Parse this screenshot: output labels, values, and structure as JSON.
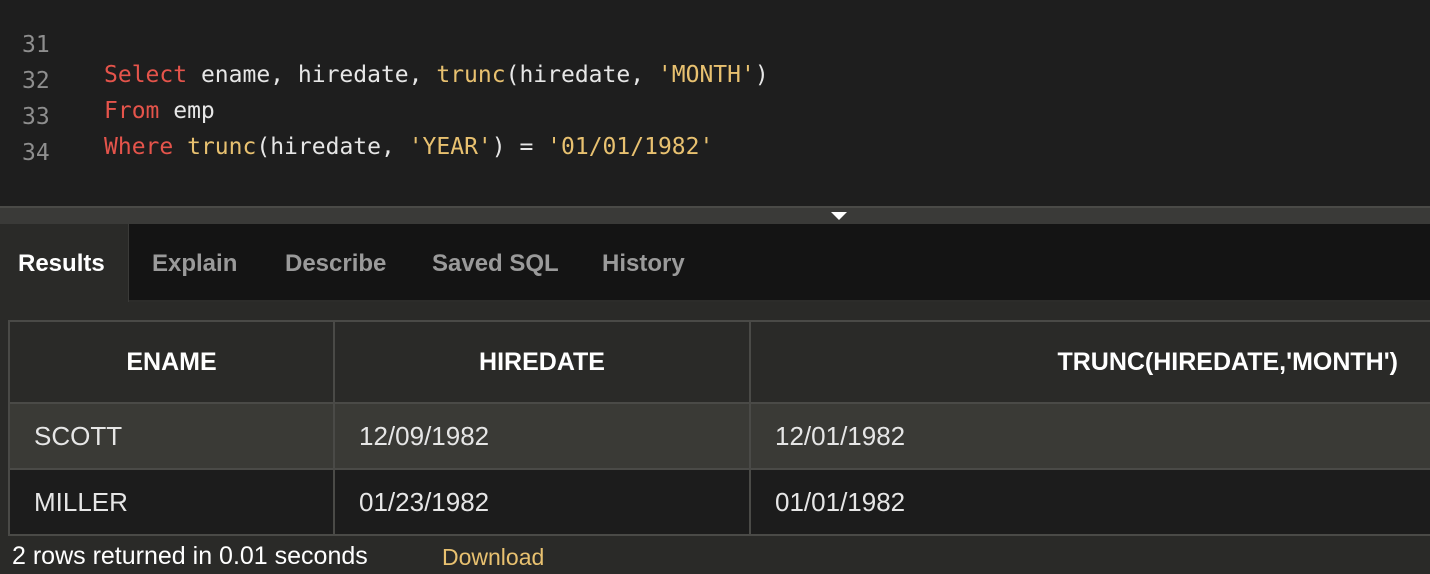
{
  "editor": {
    "lines": [
      {
        "number": "31",
        "t1": "Select",
        "t2": " ename, hiredate, ",
        "t3": "trunc",
        "t4": "(hiredate, ",
        "t5": "'MONTH'",
        "t6": ")"
      },
      {
        "number": "32",
        "t1": "From",
        "t2": " emp"
      },
      {
        "number": "33",
        "t1": "Where",
        "t2": " ",
        "t3": "trunc",
        "t4": "(hiredate, ",
        "t5": "'YEAR'",
        "t6": ") = ",
        "t7": "'01/01/1982'"
      },
      {
        "number": "34"
      }
    ]
  },
  "tabs": [
    "Results",
    "Explain",
    "Describe",
    "Saved SQL",
    "History"
  ],
  "results": {
    "columns": [
      "ENAME",
      "HIREDATE",
      "TRUNC(HIREDATE,'MONTH')"
    ],
    "rows": [
      [
        "SCOTT",
        "12/09/1982",
        "12/01/1982"
      ],
      [
        "MILLER",
        "01/23/1982",
        "01/01/1982"
      ]
    ],
    "summary": "2 rows returned in 0.01 seconds",
    "download_label": "Download"
  },
  "colors": {
    "keyword": "#e5544b",
    "function": "#e8c170",
    "string": "#e8c170",
    "link": "#e8c170",
    "background": "#1e1e1e"
  }
}
